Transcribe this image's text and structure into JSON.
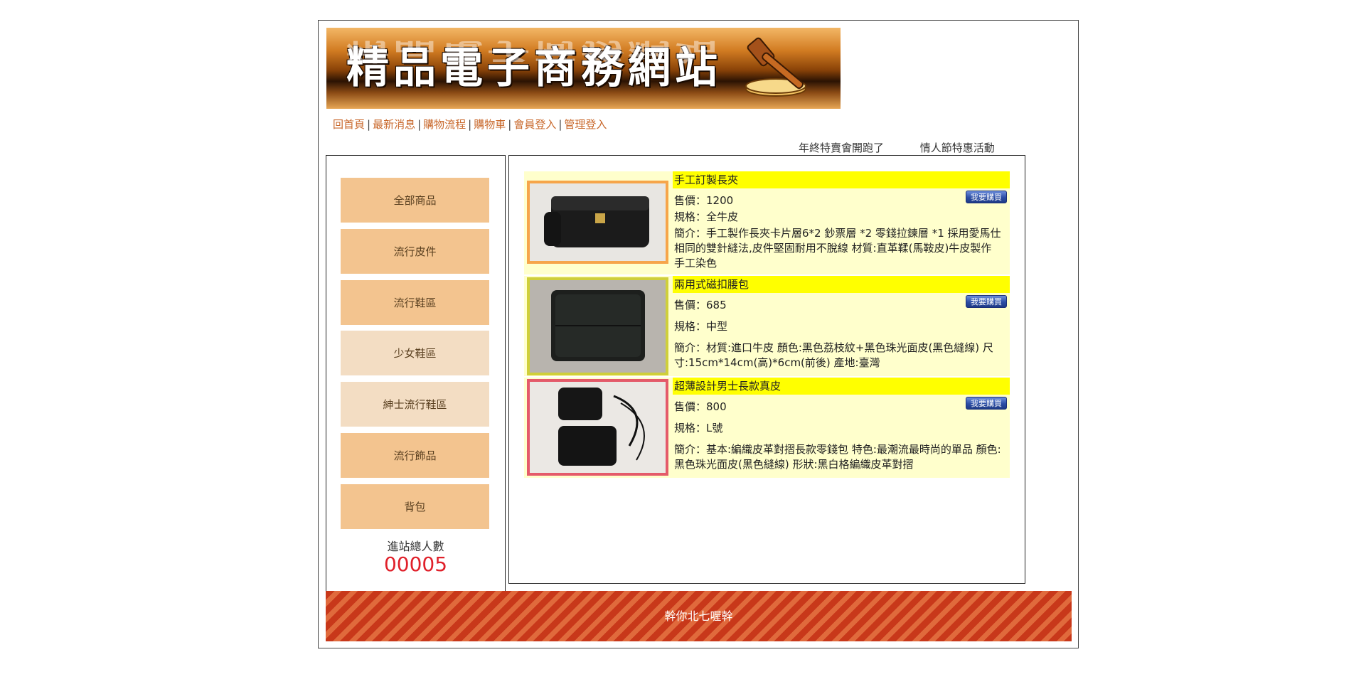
{
  "banner": {
    "title": "精品電子商務網站",
    "reflection": "精品電子商務網站"
  },
  "nav": {
    "items": [
      "回首頁",
      "最新消息",
      "購物流程",
      "購物車",
      "會員登入",
      "管理登入"
    ],
    "separator": "|"
  },
  "marquee": [
    "年終特賣會開跑了",
    "情人節特惠活動"
  ],
  "sidebar": {
    "categories": [
      "全部商品",
      "流行皮件",
      "流行鞋區",
      "少女鞋區",
      "紳士流行鞋區",
      "流行飾品",
      "背包"
    ],
    "counter_label": "進站總人數",
    "counter_value": "00005"
  },
  "products": [
    {
      "title": "手工訂製長夾",
      "price": "售價：1200",
      "spec": "規格：全牛皮",
      "desc": "簡介：手工製作長夾卡片層6*2 鈔票層 *2 零錢拉鍊層 *1 採用愛馬仕相同的雙針縫法,皮件堅固耐用不脫線 材質:直革鞣(馬鞍皮)牛皮製作 手工染色",
      "buy_label": "我要購買"
    },
    {
      "title": "兩用式磁扣腰包",
      "price": "售價：685",
      "spec": "規格：中型",
      "desc": "簡介：材質:進口牛皮 顏色:黑色荔枝紋+黑色珠光面皮(黑色縫線) 尺寸:15cm*14cm(高)*6cm(前後) 產地:臺灣",
      "buy_label": "我要購買"
    },
    {
      "title": "超薄設計男士長款真皮",
      "price": "售價：800",
      "spec": "規格：L號",
      "desc": "簡介：基本:編織皮革對摺長款零錢包 特色:最潮流最時尚的單品 顏色:黑色珠光面皮(黑色縫線) 形狀:黑白格編織皮革對摺",
      "buy_label": "我要購買"
    }
  ],
  "footer": {
    "text": "幹你北七喔幹"
  },
  "colors": {
    "nav_link": "#c8672a",
    "category_button": "#f3c48f",
    "category_button_light": "#f3ddc3",
    "product_bg": "#ffffcc",
    "product_title_bg": "#ffff00",
    "counter": "#e0202a",
    "footer": "#c8381a"
  }
}
